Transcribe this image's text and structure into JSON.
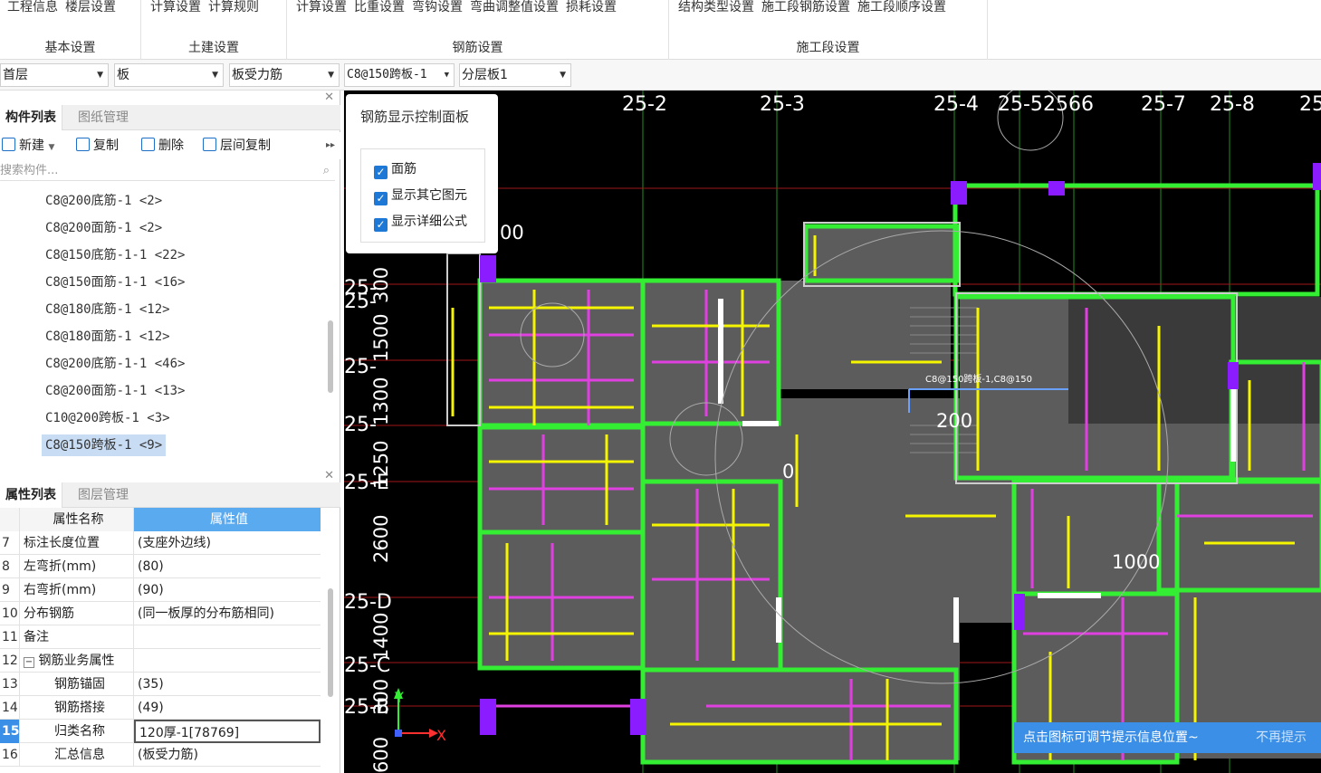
{
  "ribbon": {
    "groups": [
      {
        "title": "基本设置",
        "items": [
          "工程信息",
          "楼层设置"
        ]
      },
      {
        "title": "土建设置",
        "items": [
          "计算设置",
          "计算规则"
        ]
      },
      {
        "title": "钢筋设置",
        "items": [
          "计算设置",
          "比重设置",
          "弯钩设置",
          "弯曲调整值设置",
          "损耗设置"
        ]
      },
      {
        "title": "施工段设置",
        "items": [
          "结构类型设置",
          "施工段钢筋设置",
          "施工段顺序设置"
        ]
      }
    ]
  },
  "toolbar": {
    "floor": "首层",
    "type": "板",
    "subtype": "板受力筋",
    "component": "C8@150跨板-1",
    "layer": "分层板1"
  },
  "components_panel": {
    "tabs": [
      "构件列表",
      "图纸管理"
    ],
    "actions": {
      "new": "新建",
      "copy": "复制",
      "delete": "删除",
      "floor_copy": "层间复制"
    },
    "search_placeholder": "搜索构件...",
    "items": [
      "C8@200底筋-1 <2>",
      "C8@200面筋-1 <2>",
      "C8@150底筋-1-1 <22>",
      "C8@150面筋-1-1 <16>",
      "C8@180底筋-1 <12>",
      "C8@180面筋-1 <12>",
      "C8@200底筋-1-1 <46>",
      "C8@200面筋-1-1 <13>",
      "C10@200跨板-1 <3>",
      "C8@150跨板-1 <9>"
    ],
    "selected_index": 9
  },
  "properties_panel": {
    "tabs": [
      "属性列表",
      "图层管理"
    ],
    "header": {
      "name": "属性名称",
      "value": "属性值"
    },
    "rows": [
      {
        "num": "7",
        "name": "标注长度位置",
        "value": "(支座外边线)"
      },
      {
        "num": "8",
        "name": "左弯折(mm)",
        "value": "(80)"
      },
      {
        "num": "9",
        "name": "右弯折(mm)",
        "value": "(90)"
      },
      {
        "num": "10",
        "name": "分布钢筋",
        "value": "(同一板厚的分布筋相同)"
      },
      {
        "num": "11",
        "name": "备注",
        "value": ""
      },
      {
        "num": "12",
        "name": "钢筋业务属性",
        "value": ""
      },
      {
        "num": "13",
        "name": "钢筋锚固",
        "value": "(35)"
      },
      {
        "num": "14",
        "name": "钢筋搭接",
        "value": "(49)"
      },
      {
        "num": "15",
        "name": "归类名称",
        "value": "120厚-1[78769]"
      },
      {
        "num": "16",
        "name": "汇总信息",
        "value": "(板受力筋)"
      }
    ]
  },
  "rebar_panel": {
    "title": "钢筋显示控制面板",
    "options": [
      "面筋",
      "显示其它图元",
      "显示详细公式"
    ]
  },
  "canvas": {
    "axis_labels_top": [
      "25-2",
      "25-3",
      "25-4",
      "25-5",
      "2566",
      "25-7",
      "25-8",
      "25"
    ],
    "axis_labels_left": [
      "25-",
      "25-",
      "25-",
      "25-",
      "25-E",
      "25-D",
      "25-C",
      "25-B"
    ],
    "dims_vertical": [
      "300",
      "1500",
      "1300",
      "1250",
      "2600",
      "1400",
      "300",
      "600"
    ],
    "dims_other": [
      "00",
      "200",
      "0",
      "1000"
    ],
    "rebar_label": "C8@150跨板-1,C8@150",
    "axis_x": "X",
    "axis_y": "Y"
  },
  "hint": {
    "text": "点击图标可调节提示信息位置~",
    "dismiss": "不再提示"
  },
  "colors": {
    "accent": "#1e78d6",
    "header_blue": "#5aaaf0",
    "canvas_bg": "#000000",
    "wall_green": "#33ee33",
    "rebar_yellow": "#f5f500",
    "rebar_magenta": "#e040e0",
    "hint_bg": "#3b8fe6"
  }
}
